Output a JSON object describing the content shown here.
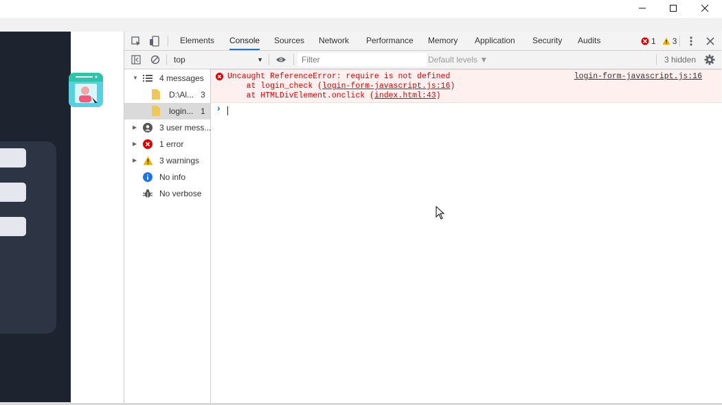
{
  "window": {
    "minimize_icon": "minimize-icon",
    "maximize_icon": "maximize-icon",
    "close_icon": "close-icon"
  },
  "devtools": {
    "tabs": [
      {
        "label": "Elements",
        "active": false
      },
      {
        "label": "Console",
        "active": true
      },
      {
        "label": "Sources",
        "active": false
      },
      {
        "label": "Network",
        "active": false
      },
      {
        "label": "Performance",
        "active": false
      },
      {
        "label": "Memory",
        "active": false
      },
      {
        "label": "Application",
        "active": false
      },
      {
        "label": "Security",
        "active": false
      },
      {
        "label": "Audits",
        "active": false
      }
    ],
    "error_count": "1",
    "warning_count": "3",
    "colors": {
      "accent": "#1a73e8",
      "error": "#e00000",
      "warning": "#f0b400",
      "info": "#1a73e8"
    }
  },
  "console_toolbar": {
    "context": "top",
    "filter_placeholder": "Filter",
    "levels": "Default levels ▼",
    "hidden": "3 hidden"
  },
  "sidebar": {
    "items": [
      {
        "label": "4 messages",
        "count": "",
        "icon": "list-icon"
      },
      {
        "label": "D:\\Al...",
        "count": "3",
        "icon": "file-icon"
      },
      {
        "label": "login...",
        "count": "1",
        "icon": "file-icon"
      },
      {
        "label": "3 user mess...",
        "count": "",
        "icon": "user-icon"
      },
      {
        "label": "1 error",
        "count": "",
        "icon": "error-icon"
      },
      {
        "label": "3 warnings",
        "count": "",
        "icon": "warning-icon"
      },
      {
        "label": "No info",
        "count": "",
        "icon": "info-icon"
      },
      {
        "label": "No verbose",
        "count": "",
        "icon": "bug-icon"
      }
    ]
  },
  "console": {
    "error_line1": "Uncaught ReferenceError: require is not defined",
    "error_line2_prefix": "    at login_check (",
    "error_line2_link": "login-form-javascript.js:16",
    "error_line2_suffix": ")",
    "error_line3_prefix": "    at HTMLDivElement.onclick (",
    "error_line3_link": "index.html:43",
    "error_line3_suffix": ")",
    "source_link": "login-form-javascript.js:16",
    "prompt": "›"
  }
}
